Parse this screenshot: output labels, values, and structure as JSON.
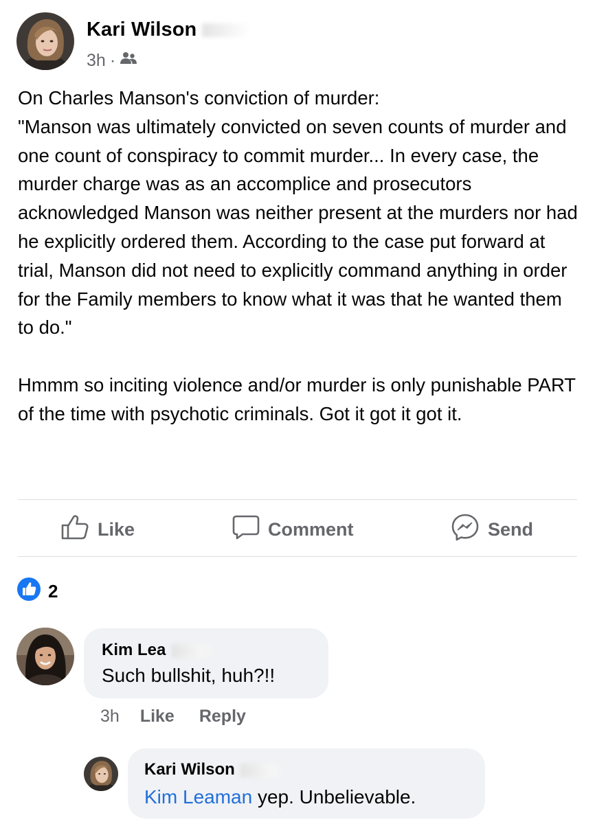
{
  "post": {
    "author": "Kari Wilson",
    "timestamp": "3h",
    "separator": "·",
    "audience_icon": "friends-icon",
    "body": "On Charles Manson's conviction of murder:\n\"Manson was ultimately convicted on seven counts of murder and one count of conspiracy to commit murder... In every case, the murder charge was as an accomplice and prosecutors acknowledged Manson was neither present at the murders nor had he explicitly ordered them. According to the case put forward at trial, Manson did not need to explicitly command anything in order for the Family members to know what it was that he wanted them to do.\"\n\nHmmm so inciting violence and/or murder is only punishable PART of the time with psychotic criminals. Got it got it got it."
  },
  "actions": {
    "like_label": "Like",
    "comment_label": "Comment",
    "send_label": "Send"
  },
  "reactions": {
    "icon": "thumbs-up-reaction-icon",
    "count": "2"
  },
  "comments": [
    {
      "author": "Kim Lea",
      "text": "Such bullshit, huh?!!",
      "time": "3h",
      "like_label": "Like",
      "reply_label": "Reply"
    }
  ],
  "replies": [
    {
      "author": "Kari Wilson",
      "mention": "Kim Leaman",
      "text": " yep. Unbelievable."
    }
  ],
  "colors": {
    "meta_gray": "#65676b",
    "bubble_bg": "#f0f2f5",
    "link_blue": "#216fdb",
    "like_blue": "#1877f2"
  }
}
